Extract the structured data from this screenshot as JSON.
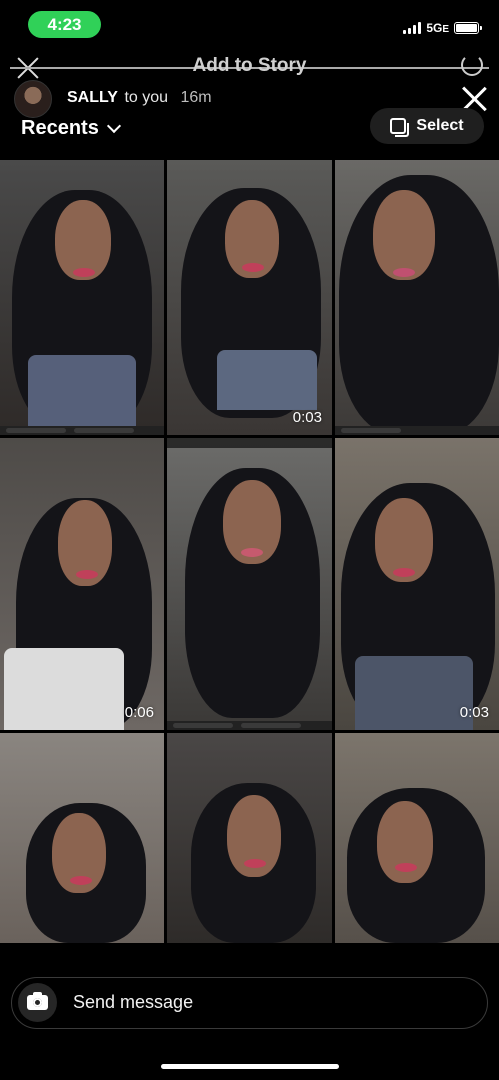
{
  "status_bar": {
    "time": "4:23",
    "network": "5G",
    "network_suffix": "E",
    "time_pill_color": "#30d158"
  },
  "story_header": {
    "title": "Add to Story"
  },
  "message": {
    "sender": "SALLY",
    "recipient_text": "to you",
    "age": "16m"
  },
  "gallery": {
    "album": "Recents",
    "select_label": "Select"
  },
  "tiles": [
    {
      "kind": "photo"
    },
    {
      "kind": "video",
      "duration": "0:03"
    },
    {
      "kind": "photo"
    },
    {
      "kind": "video",
      "duration": "0:06"
    },
    {
      "kind": "screenshot"
    },
    {
      "kind": "video",
      "duration": "0:03"
    },
    {
      "kind": "photo"
    },
    {
      "kind": "photo"
    },
    {
      "kind": "photo"
    }
  ],
  "composer": {
    "placeholder": "Send message"
  },
  "colors": {
    "background": "#000000",
    "select_button_bg": "#1f1f1f",
    "composer_border": "#3a3a3a"
  },
  "icons": [
    "close-icon",
    "settings-icon",
    "chevron-down-icon",
    "select-icon",
    "camera-icon"
  ]
}
